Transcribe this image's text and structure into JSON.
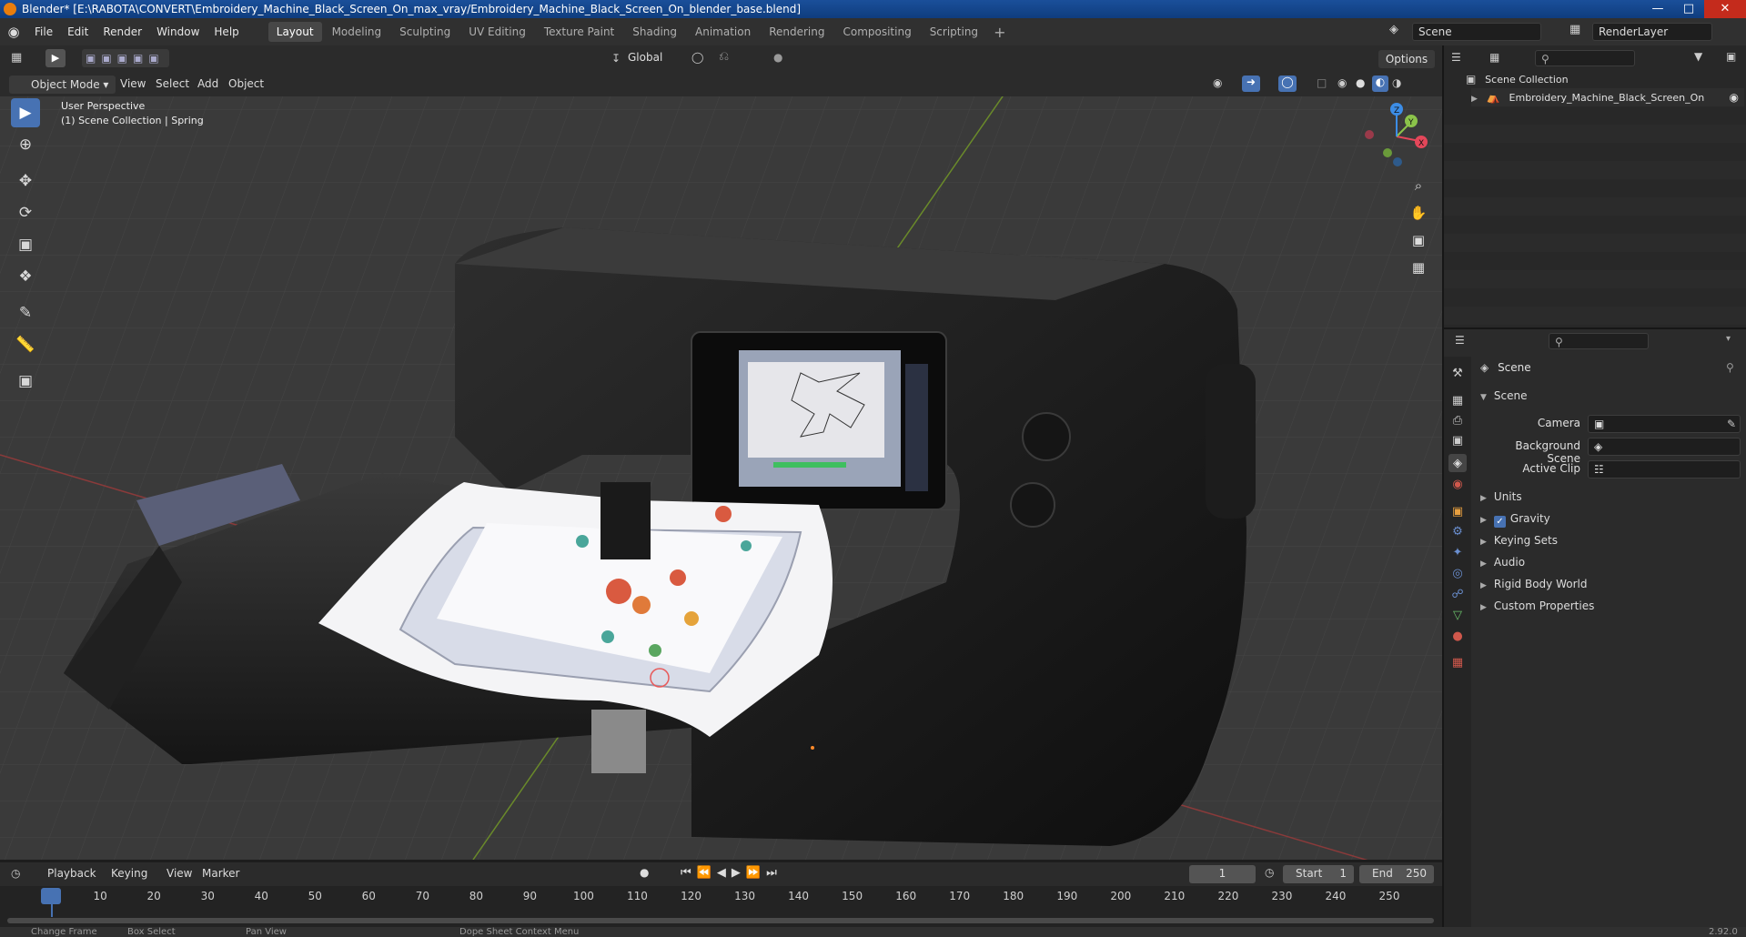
{
  "window": {
    "title": "Blender* [E:\\RABOTA\\CONVERT\\Embroidery_Machine_Black_Screen_On_max_vray/Embroidery_Machine_Black_Screen_On_blender_base.blend]"
  },
  "menu": [
    "File",
    "Edit",
    "Render",
    "Window",
    "Help"
  ],
  "workspaces": [
    "Layout",
    "Modeling",
    "Sculpting",
    "UV Editing",
    "Texture Paint",
    "Shading",
    "Animation",
    "Rendering",
    "Compositing",
    "Scripting"
  ],
  "active_workspace": "Layout",
  "scene_field": "Scene",
  "renderlayer_field": "RenderLayer",
  "viewport_header": {
    "mode": "Object Mode",
    "menus": [
      "View",
      "Select",
      "Add",
      "Object"
    ],
    "transform_orientation": "Global",
    "options": "Options"
  },
  "viewport_overlay": {
    "perspective": "User Perspective",
    "collection": "(1) Scene Collection | Spring"
  },
  "gizmo": {
    "x": "X",
    "y": "Y",
    "z": "Z"
  },
  "outliner": {
    "root": "Scene Collection",
    "items": [
      "Embroidery_Machine_Black_Screen_On"
    ]
  },
  "properties": {
    "header": "Scene",
    "panel": "Scene",
    "fields": [
      {
        "label": "Camera",
        "value": ""
      },
      {
        "label": "Background Scene",
        "value": ""
      },
      {
        "label": "Active Clip",
        "value": ""
      }
    ],
    "sections": [
      "Units",
      "Gravity",
      "Keying Sets",
      "Audio",
      "Rigid Body World",
      "Custom Properties"
    ],
    "gravity_checked": true
  },
  "timeline": {
    "menus": [
      "Playback",
      "Keying",
      "View",
      "Marker"
    ],
    "current_frame": "1",
    "start_label": "Start",
    "start": "1",
    "end_label": "End",
    "end": "250",
    "ticks": [
      "1",
      "10",
      "20",
      "30",
      "40",
      "50",
      "60",
      "70",
      "80",
      "90",
      "100",
      "110",
      "120",
      "130",
      "140",
      "150",
      "160",
      "170",
      "180",
      "190",
      "200",
      "210",
      "220",
      "230",
      "240",
      "250"
    ]
  },
  "statusbar": {
    "items": [
      "Change Frame",
      "Box Select",
      "Pan View",
      "Dope Sheet Context Menu"
    ],
    "version": "2.92.0"
  },
  "colors": {
    "accent": "#4772b3",
    "title_bar": "#1a4f9a",
    "axis_x": "#e4475a",
    "axis_y": "#8bc34a",
    "axis_z": "#3c8de6"
  }
}
